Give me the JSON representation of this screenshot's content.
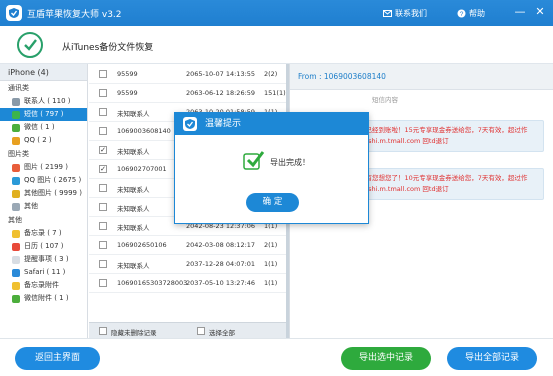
{
  "window": {
    "title": "互盾苹果恢复大师 v3.2",
    "contact": "联系我们",
    "help": "帮助",
    "minimize": "—",
    "close": "✕"
  },
  "header": {
    "title": "从iTunes备份文件恢复"
  },
  "sidebar": {
    "device": "iPhone (4)",
    "categories": [
      {
        "label": "通讯类",
        "items": [
          {
            "label": "联系人 ( 110 )",
            "color": "#8a9aa8"
          },
          {
            "label": "短信 ( 797 )",
            "color": "#3cb44b",
            "active": true
          },
          {
            "label": "微信 ( 1 )",
            "color": "#4cae3c"
          },
          {
            "label": "QQ ( 2 )",
            "color": "#e8a020"
          }
        ]
      },
      {
        "label": "图片类",
        "items": [
          {
            "label": "图片 ( 2199 )",
            "color": "#e85d3a"
          },
          {
            "label": "QQ 图片 ( 2675 )",
            "color": "#2a9ad8"
          },
          {
            "label": "其他图片 ( 9999 )",
            "color": "#e0b020"
          },
          {
            "label": "其他",
            "color": "#9aa8b5"
          }
        ]
      },
      {
        "label": "其他",
        "items": [
          {
            "label": "备忘录 ( 7 )",
            "color": "#f0c030"
          },
          {
            "label": "日历 ( 107 )",
            "color": "#e84a3a"
          },
          {
            "label": "提醒事项 ( 3 )",
            "color": "#d8dde3"
          },
          {
            "label": "Safari ( 11 )",
            "color": "#2a8ad8"
          },
          {
            "label": "备忘录附件",
            "color": "#f0c030"
          },
          {
            "label": "微信附件 ( 1 )",
            "color": "#4cae3c"
          }
        ]
      }
    ]
  },
  "list": {
    "rows": [
      {
        "checked": false,
        "from": "95599",
        "date": "2065-10-07 14:13:55",
        "count": "2(2)"
      },
      {
        "checked": false,
        "from": "95599",
        "date": "2063-06-12 18:26:59",
        "count": "151(1)"
      },
      {
        "checked": false,
        "from": "未知联系人",
        "date": "2063-10-20 01:58:59",
        "count": "1(1)"
      },
      {
        "checked": false,
        "from": "1069003608140",
        "date": "",
        "count": ""
      },
      {
        "checked": true,
        "from": "未知联系人",
        "date": "",
        "count": ""
      },
      {
        "checked": true,
        "from": "106902707001",
        "date": "",
        "count": ""
      },
      {
        "checked": false,
        "from": "未知联系人",
        "date": "",
        "count": ""
      },
      {
        "checked": false,
        "from": "未知联系人",
        "date": "2054-12-08 09:37:45",
        "count": "1(1)"
      },
      {
        "checked": false,
        "from": "未知联系人",
        "date": "2042-08-23 12:37:06",
        "count": "1(1)"
      },
      {
        "checked": false,
        "from": "106902650106",
        "date": "2042-03-08 08:12:17",
        "count": "2(1)"
      },
      {
        "checked": false,
        "from": "未知联系人",
        "date": "2037-12-28 04:07:01",
        "count": "1(1)"
      },
      {
        "checked": false,
        "from": "10690165303728003",
        "date": "2037-05-10 13:27:46",
        "count": "1(1)"
      }
    ],
    "footer": {
      "hide_deleted": "隐藏未删除记录",
      "select_all": "选择全部"
    }
  },
  "detail": {
    "from": "From : 1069003608140",
    "sms_header": "短信内容",
    "messages": [
      "您的淘宝店铺优惠券已经到账啦！15元专享现金券送给您，7天有效，超过作废！赶紧查看：chaoshi.m.tmall.com 回td退订",
      "【天猫】您的账户里有您想您了！10元专享现金券送给您，7天有效，超过作废！赶紧查看：chaoshi.m.tmall.com 回td退订"
    ]
  },
  "buttons": {
    "back": "返回主界面",
    "export_selected": "导出选中记录",
    "export_all": "导出全部记录"
  },
  "dialog": {
    "title": "温馨提示",
    "message": "导出完成！",
    "ok": "确 定"
  }
}
